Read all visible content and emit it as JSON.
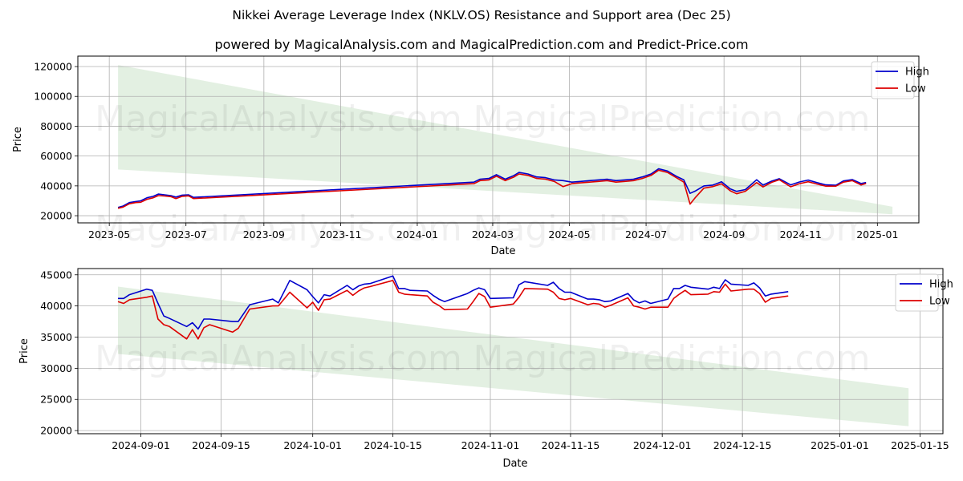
{
  "title": "Nikkei Average Leverage Index (NKLV.OS) Resistance and Support area (Dec 25)",
  "subtitle": "powered by MagicalAnalysis.com and MagicalPrediction.com and Predict-Price.com",
  "watermarks": [
    "MagicalAnalysis.com",
    "MagicalPrediction.com"
  ],
  "colors": {
    "high": "#0000cc",
    "low": "#dd0000",
    "band": "#e2efe0",
    "grid": "#b0b0b0"
  },
  "chart_data": [
    {
      "type": "line",
      "title": "",
      "xlabel": "Date",
      "ylabel": "Price",
      "xlim": [
        "2023-04-06",
        "2025-02-03"
      ],
      "ylim": [
        15200,
        127000
      ],
      "grid": true,
      "legend": "top-right",
      "x_ticks": [
        "2023-05",
        "2023-07",
        "2023-09",
        "2023-11",
        "2024-01",
        "2024-03",
        "2024-05",
        "2024-07",
        "2024-09",
        "2024-11",
        "2025-01"
      ],
      "x_tick_dates": [
        "2023-05-01",
        "2023-07-01",
        "2023-09-01",
        "2023-11-01",
        "2024-01-01",
        "2024-03-01",
        "2024-05-01",
        "2024-07-01",
        "2024-09-01",
        "2024-11-01",
        "2025-01-01"
      ],
      "y_ticks": [
        20000,
        40000,
        60000,
        80000,
        100000,
        120000
      ],
      "band": {
        "x": [
          "2023-05-08",
          "2025-01-13"
        ],
        "upper": [
          121000,
          26000
        ],
        "lower": [
          51000,
          21000
        ]
      },
      "series": [
        {
          "name": "High",
          "x": [
            "2023-05-08",
            "2023-05-12",
            "2023-05-17",
            "2023-05-22",
            "2023-05-26",
            "2023-05-31",
            "2023-06-05",
            "2023-06-09",
            "2023-06-14",
            "2023-06-19",
            "2023-06-23",
            "2023-06-28",
            "2023-07-03",
            "2023-07-07",
            "2024-02-15",
            "2024-02-20",
            "2024-02-27",
            "2024-03-04",
            "2024-03-11",
            "2024-03-18",
            "2024-03-22",
            "2024-03-29",
            "2024-04-05",
            "2024-04-12",
            "2024-04-19",
            "2024-04-26",
            "2024-05-03",
            "2024-05-10",
            "2024-05-17",
            "2024-05-24",
            "2024-05-31",
            "2024-06-07",
            "2024-06-14",
            "2024-06-21",
            "2024-06-28",
            "2024-07-05",
            "2024-07-11",
            "2024-07-18",
            "2024-07-25",
            "2024-07-31",
            "2024-08-05",
            "2024-08-09",
            "2024-08-16",
            "2024-08-23",
            "2024-08-30",
            "2024-09-06",
            "2024-09-11",
            "2024-09-18",
            "2024-09-27",
            "2024-10-02",
            "2024-10-09",
            "2024-10-15",
            "2024-10-24",
            "2024-10-31",
            "2024-11-07",
            "2024-11-14",
            "2024-11-21",
            "2024-11-29",
            "2024-12-05",
            "2024-12-12",
            "2024-12-19",
            "2024-12-23"
          ],
          "values": [
            25500,
            26500,
            28800,
            29500,
            30000,
            32000,
            33000,
            34500,
            34000,
            33500,
            32500,
            33800,
            34000,
            32300,
            42500,
            44500,
            45000,
            47500,
            44500,
            47000,
            49000,
            48000,
            46000,
            45500,
            44000,
            43500,
            42500,
            43000,
            43500,
            44000,
            44500,
            43500,
            44000,
            44500,
            46000,
            48000,
            51500,
            50000,
            46500,
            44000,
            35000,
            36500,
            40000,
            40500,
            42800,
            38000,
            36300,
            37500,
            44100,
            40500,
            43200,
            44800,
            40700,
            42600,
            43900,
            42200,
            40700,
            40400,
            43300,
            44200,
            41600,
            42300
          ]
        },
        {
          "name": "Low",
          "x": [
            "2023-05-08",
            "2023-05-12",
            "2023-05-17",
            "2023-05-22",
            "2023-05-26",
            "2023-05-31",
            "2023-06-05",
            "2023-06-09",
            "2023-06-14",
            "2023-06-19",
            "2023-06-23",
            "2023-06-28",
            "2023-07-03",
            "2023-07-07",
            "2024-02-15",
            "2024-02-20",
            "2024-02-27",
            "2024-03-04",
            "2024-03-11",
            "2024-03-18",
            "2024-03-22",
            "2024-03-29",
            "2024-04-05",
            "2024-04-12",
            "2024-04-19",
            "2024-04-26",
            "2024-05-03",
            "2024-05-10",
            "2024-05-17",
            "2024-05-24",
            "2024-05-31",
            "2024-06-07",
            "2024-06-14",
            "2024-06-21",
            "2024-06-28",
            "2024-07-05",
            "2024-07-11",
            "2024-07-18",
            "2024-07-25",
            "2024-07-31",
            "2024-08-05",
            "2024-08-09",
            "2024-08-16",
            "2024-08-23",
            "2024-08-30",
            "2024-09-06",
            "2024-09-11",
            "2024-09-18",
            "2024-09-27",
            "2024-10-02",
            "2024-10-09",
            "2024-10-15",
            "2024-10-24",
            "2024-10-31",
            "2024-11-07",
            "2024-11-14",
            "2024-11-21",
            "2024-11-29",
            "2024-12-05",
            "2024-12-12",
            "2024-12-19",
            "2024-12-23"
          ],
          "values": [
            25000,
            25800,
            28000,
            28800,
            29000,
            31000,
            32000,
            33500,
            33200,
            32800,
            31500,
            33000,
            33300,
            31500,
            41500,
            43500,
            44000,
            46500,
            43500,
            46000,
            48000,
            47000,
            45000,
            44500,
            43000,
            39500,
            41500,
            42000,
            42500,
            43000,
            43500,
            42500,
            43000,
            43500,
            45000,
            47000,
            50500,
            49000,
            45500,
            42500,
            27800,
            32000,
            38500,
            39500,
            41400,
            36700,
            34700,
            36400,
            42200,
            39300,
            42400,
            44100,
            39400,
            41500,
            42800,
            41200,
            39800,
            39800,
            42500,
            43500,
            40600,
            41600
          ]
        }
      ]
    },
    {
      "type": "line",
      "title": "",
      "xlabel": "Date",
      "ylabel": "Price",
      "xlim": [
        "2024-08-21",
        "2025-01-19"
      ],
      "ylim": [
        19500,
        46000
      ],
      "grid": true,
      "legend": "top-right",
      "x_ticks": [
        "2024-09-01",
        "2024-09-15",
        "2024-10-01",
        "2024-10-15",
        "2024-11-01",
        "2024-11-15",
        "2024-12-01",
        "2024-12-15",
        "2025-01-01",
        "2025-01-15"
      ],
      "y_ticks": [
        20000,
        25000,
        30000,
        35000,
        40000,
        45000
      ],
      "band": {
        "x": [
          "2024-08-28",
          "2025-01-13"
        ],
        "upper": [
          43100,
          26800
        ],
        "lower": [
          32300,
          20700
        ]
      },
      "series": [
        {
          "name": "High",
          "x": [
            "2024-08-28",
            "2024-08-29",
            "2024-08-30",
            "2024-09-02",
            "2024-09-03",
            "2024-09-04",
            "2024-09-05",
            "2024-09-06",
            "2024-09-09",
            "2024-09-10",
            "2024-09-11",
            "2024-09-12",
            "2024-09-13",
            "2024-09-17",
            "2024-09-18",
            "2024-09-20",
            "2024-09-24",
            "2024-09-25",
            "2024-09-27",
            "2024-09-30",
            "2024-10-01",
            "2024-10-02",
            "2024-10-03",
            "2024-10-04",
            "2024-10-07",
            "2024-10-08",
            "2024-10-09",
            "2024-10-10",
            "2024-10-11",
            "2024-10-15",
            "2024-10-16",
            "2024-10-17",
            "2024-10-18",
            "2024-10-21",
            "2024-10-22",
            "2024-10-23",
            "2024-10-24",
            "2024-10-28",
            "2024-10-29",
            "2024-10-30",
            "2024-10-31",
            "2024-11-01",
            "2024-11-05",
            "2024-11-06",
            "2024-11-07",
            "2024-11-11",
            "2024-11-12",
            "2024-11-13",
            "2024-11-14",
            "2024-11-15",
            "2024-11-18",
            "2024-11-19",
            "2024-11-20",
            "2024-11-21",
            "2024-11-22",
            "2024-11-25",
            "2024-11-26",
            "2024-11-27",
            "2024-11-28",
            "2024-11-29",
            "2024-12-02",
            "2024-12-03",
            "2024-12-04",
            "2024-12-05",
            "2024-12-06",
            "2024-12-09",
            "2024-12-10",
            "2024-12-11",
            "2024-12-12",
            "2024-12-13",
            "2024-12-16",
            "2024-12-17",
            "2024-12-18",
            "2024-12-19",
            "2024-12-20",
            "2024-12-23"
          ],
          "values": [
            41200,
            41200,
            41800,
            42700,
            42500,
            40400,
            38400,
            38000,
            36700,
            37300,
            36300,
            37900,
            37900,
            37500,
            37500,
            40200,
            41100,
            40500,
            44100,
            42600,
            41500,
            40500,
            41800,
            41600,
            43300,
            42600,
            43200,
            43500,
            43600,
            44800,
            42800,
            42800,
            42500,
            42400,
            41700,
            41100,
            40700,
            42000,
            42500,
            42900,
            42600,
            41200,
            41300,
            43400,
            43900,
            43300,
            43800,
            42800,
            42200,
            42200,
            41100,
            41100,
            41000,
            40700,
            40800,
            42000,
            41000,
            40500,
            40800,
            40400,
            41100,
            42800,
            42800,
            43300,
            43000,
            42700,
            43000,
            42800,
            44200,
            43500,
            43300,
            43700,
            42900,
            41600,
            41900,
            42300
          ]
        },
        {
          "name": "Low",
          "x": [
            "2024-08-28",
            "2024-08-29",
            "2024-08-30",
            "2024-09-02",
            "2024-09-03",
            "2024-09-04",
            "2024-09-05",
            "2024-09-06",
            "2024-09-09",
            "2024-09-10",
            "2024-09-11",
            "2024-09-12",
            "2024-09-13",
            "2024-09-17",
            "2024-09-18",
            "2024-09-20",
            "2024-09-24",
            "2024-09-25",
            "2024-09-27",
            "2024-09-30",
            "2024-10-01",
            "2024-10-02",
            "2024-10-03",
            "2024-10-04",
            "2024-10-07",
            "2024-10-08",
            "2024-10-09",
            "2024-10-10",
            "2024-10-11",
            "2024-10-15",
            "2024-10-16",
            "2024-10-17",
            "2024-10-18",
            "2024-10-21",
            "2024-10-22",
            "2024-10-23",
            "2024-10-24",
            "2024-10-28",
            "2024-10-29",
            "2024-10-30",
            "2024-10-31",
            "2024-11-01",
            "2024-11-05",
            "2024-11-06",
            "2024-11-07",
            "2024-11-11",
            "2024-11-12",
            "2024-11-13",
            "2024-11-14",
            "2024-11-15",
            "2024-11-18",
            "2024-11-19",
            "2024-11-20",
            "2024-11-21",
            "2024-11-22",
            "2024-11-25",
            "2024-11-26",
            "2024-11-27",
            "2024-11-28",
            "2024-11-29",
            "2024-12-02",
            "2024-12-03",
            "2024-12-04",
            "2024-12-05",
            "2024-12-06",
            "2024-12-09",
            "2024-12-10",
            "2024-12-11",
            "2024-12-12",
            "2024-12-13",
            "2024-12-16",
            "2024-12-17",
            "2024-12-18",
            "2024-12-19",
            "2024-12-20",
            "2024-12-23"
          ],
          "values": [
            40700,
            40400,
            41000,
            41400,
            41600,
            37900,
            37000,
            36700,
            34700,
            36200,
            34700,
            36500,
            37000,
            35800,
            36400,
            39500,
            40000,
            40000,
            42200,
            39700,
            40600,
            39300,
            41000,
            41100,
            42500,
            41700,
            42400,
            42900,
            43100,
            44100,
            42200,
            41900,
            41800,
            41600,
            40600,
            40100,
            39400,
            39500,
            40700,
            42000,
            41500,
            39800,
            40300,
            41400,
            42800,
            42700,
            42200,
            41200,
            41000,
            41200,
            40200,
            40400,
            40300,
            39800,
            40100,
            41300,
            40000,
            39800,
            39500,
            39800,
            39800,
            41200,
            41900,
            42500,
            41800,
            41900,
            42300,
            42200,
            43500,
            42400,
            42700,
            42700,
            42000,
            40600,
            41200,
            41600
          ]
        }
      ]
    }
  ]
}
